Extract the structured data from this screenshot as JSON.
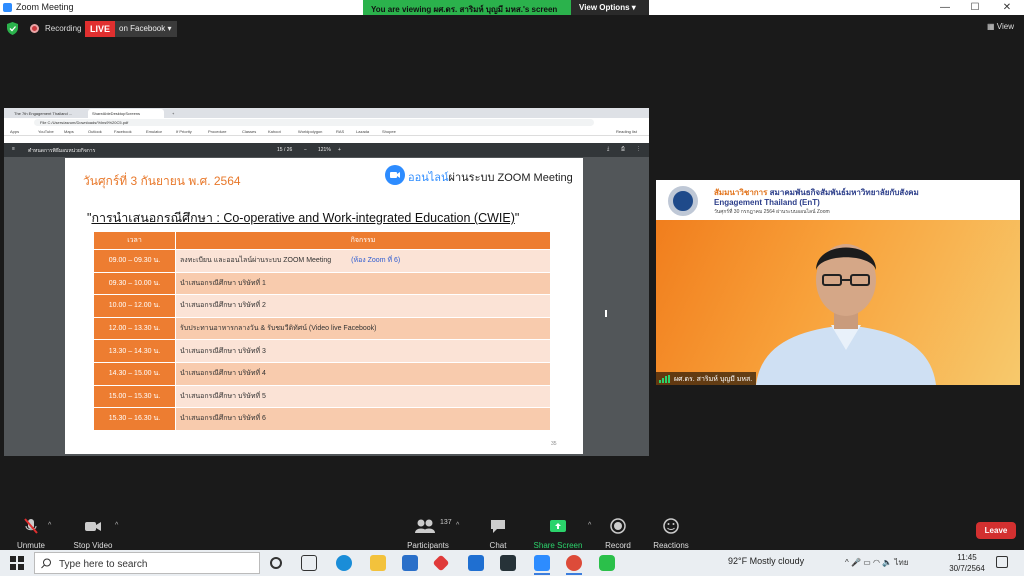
{
  "zoom": {
    "window_title": "Zoom Meeting",
    "viewing_banner": "You are viewing ผศ.ดร. สาริมห์ บุญมี มหส.'s screen",
    "view_options": "View Options ▾",
    "recording_label": "Recording",
    "live_badge": "LIVE",
    "live_target": "on Facebook ▾",
    "view_label": "▦ View",
    "toolbar": {
      "unmute": "Unmute",
      "stop_video": "Stop Video",
      "participants": "Participants",
      "participants_count": "137",
      "chat": "Chat",
      "share_screen": "Share Screen",
      "record": "Record",
      "reactions": "Reactions",
      "leave": "Leave"
    }
  },
  "browser": {
    "tabs": [
      "The 7th Engagement Thailand ...",
      "ShareAbleDesktopScreens"
    ],
    "url": "File  C:/Users/asrum/Downloads/%Ins9%20C5.pdf",
    "bookmarks": [
      "Apps",
      "YouTube",
      "Maps",
      "Outlook",
      "Facebook",
      "Emulator",
      "If Priority",
      "Procedure",
      "Classes",
      "Kahoot",
      "Worldpolygon",
      "RAS",
      "Lazada",
      "Shopee",
      "Reading list"
    ],
    "pdf_filename": "ตำหนดการพิธีมอบหน่วยกิจการ",
    "pdf_page": "15 / 26",
    "pdf_zoom": "121%"
  },
  "slide": {
    "date": "วันศุกร์ที่ 3 กันยายน พ.ศ. 2564",
    "online_prefix": "ออนไลน์",
    "online_suffix": "ผ่านระบบ ZOOM Meeting",
    "heading_quote_open": "\"",
    "heading": "การนำเสนอกรณีศึกษา : Co-operative and Work-integrated Education (CWIE)",
    "heading_quote_close": "\"",
    "col_time": "เวลา",
    "col_activity": "กิจกรรม",
    "rows": [
      {
        "time": "09.00 – 09.30 น.",
        "activity": "ลงทะเบียน และออนไลน์ผ่านระบบ ZOOM Meeting",
        "note": "(ห้อง Zoom ที่ 6)"
      },
      {
        "time": "09.30 – 10.00 น.",
        "activity": "นำเสนอกรณีศึกษา บริษัทที่ 1",
        "note": ""
      },
      {
        "time": "10.00 – 12.00 น.",
        "activity": "นำเสนอกรณีศึกษา บริษัทที่ 2",
        "note": ""
      },
      {
        "time": "12.00 – 13.30 น.",
        "activity": "รับประทานอาหารกลางวัน & รับชมวีดิทัศน์ (Video live Facebook)",
        "note": ""
      },
      {
        "time": "13.30 – 14.30 น.",
        "activity": "นำเสนอกรณีศึกษา บริษัทที่ 3",
        "note": ""
      },
      {
        "time": "14.30 – 15.00 น.",
        "activity": "นำเสนอกรณีศึกษา บริษัทที่ 4",
        "note": ""
      },
      {
        "time": "15.00 – 15.30 น.",
        "activity": "นำเสนอกรณีศึกษา บริษัทที่ 5",
        "note": ""
      },
      {
        "time": "15.30 – 16.30 น.",
        "activity": "นำเสนอกรณีศึกษา บริษัทที่ 6",
        "note": ""
      }
    ],
    "page_number": "35"
  },
  "speaker": {
    "banner_line1_a": "สัมมนาวิชาการ",
    "banner_line1_b": "สมาคมพันธกิจสัมพันธ์มหาวิทยาลัยกับสังคม",
    "banner_line2": "Engagement Thailand (EnT)",
    "banner_line3": "วันศุกร์ที่ 30 กรกฎาคม 2564 ผ่านระบบออนไลน์ Zoom",
    "name": "ผศ.ดร. สาริมห์ บุญมี มหส."
  },
  "taskbar": {
    "search_placeholder": "Type here to search",
    "weather": "92°F  Mostly cloudy",
    "tray_lang": "ไทย",
    "time": "11:45",
    "date": "30/7/2564"
  }
}
